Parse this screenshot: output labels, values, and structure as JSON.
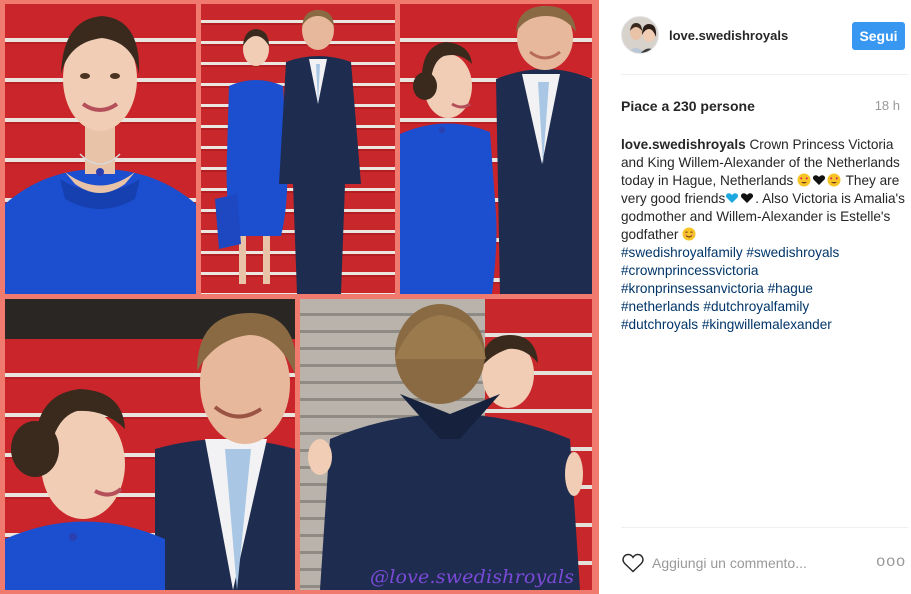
{
  "post": {
    "username": "love.swedishroyals",
    "follow_label": "Segui",
    "likes_text": "Piace a 230 persone",
    "time_ago": "18 h",
    "caption": {
      "username": "love.swedishroyals",
      "text_1": " Crown Princess Victoria and King Willem-Alexander of the Netherlands today in Hague, Netherlands ",
      "emoji_1": [
        "heart-eyes",
        "black-heart",
        "heart-eyes"
      ],
      "text_2": " They are very good friends",
      "emoji_2": [
        "blue-heart",
        "black-heart"
      ],
      "text_3": ". Also Victoria is Amalia's godmother and Willem-Alexander is Estelle's godfather ",
      "emoji_3": [
        "smiling-face"
      ],
      "hashtags": [
        "#swedishroyalfamily",
        "#swedishroyals",
        "#crownprincessvictoria",
        "#kronprinsessanvictoria",
        "#hague",
        "#netherlands",
        "#dutchroyalfamily",
        "#dutchroyals",
        "#kingwillemalexander"
      ]
    },
    "comment_placeholder": "Aggiungi un commento...",
    "more_label": "ooo"
  },
  "image": {
    "watermark": "@love.swedishroyals",
    "photos": [
      {
        "name": "photo-victoria-portrait"
      },
      {
        "name": "photo-couple-on-stairs"
      },
      {
        "name": "photo-victoria-and-king-talking"
      },
      {
        "name": "photo-closeup-smiling"
      },
      {
        "name": "photo-embrace"
      }
    ]
  },
  "colors": {
    "accent": "#3897f0",
    "collage_border": "#f07a6e",
    "hashtag": "#003569",
    "muted_text": "#999999",
    "dress_blue": "#1b4fcf",
    "carpet_red": "#c9252a",
    "suit_navy": "#1e2c4f"
  }
}
